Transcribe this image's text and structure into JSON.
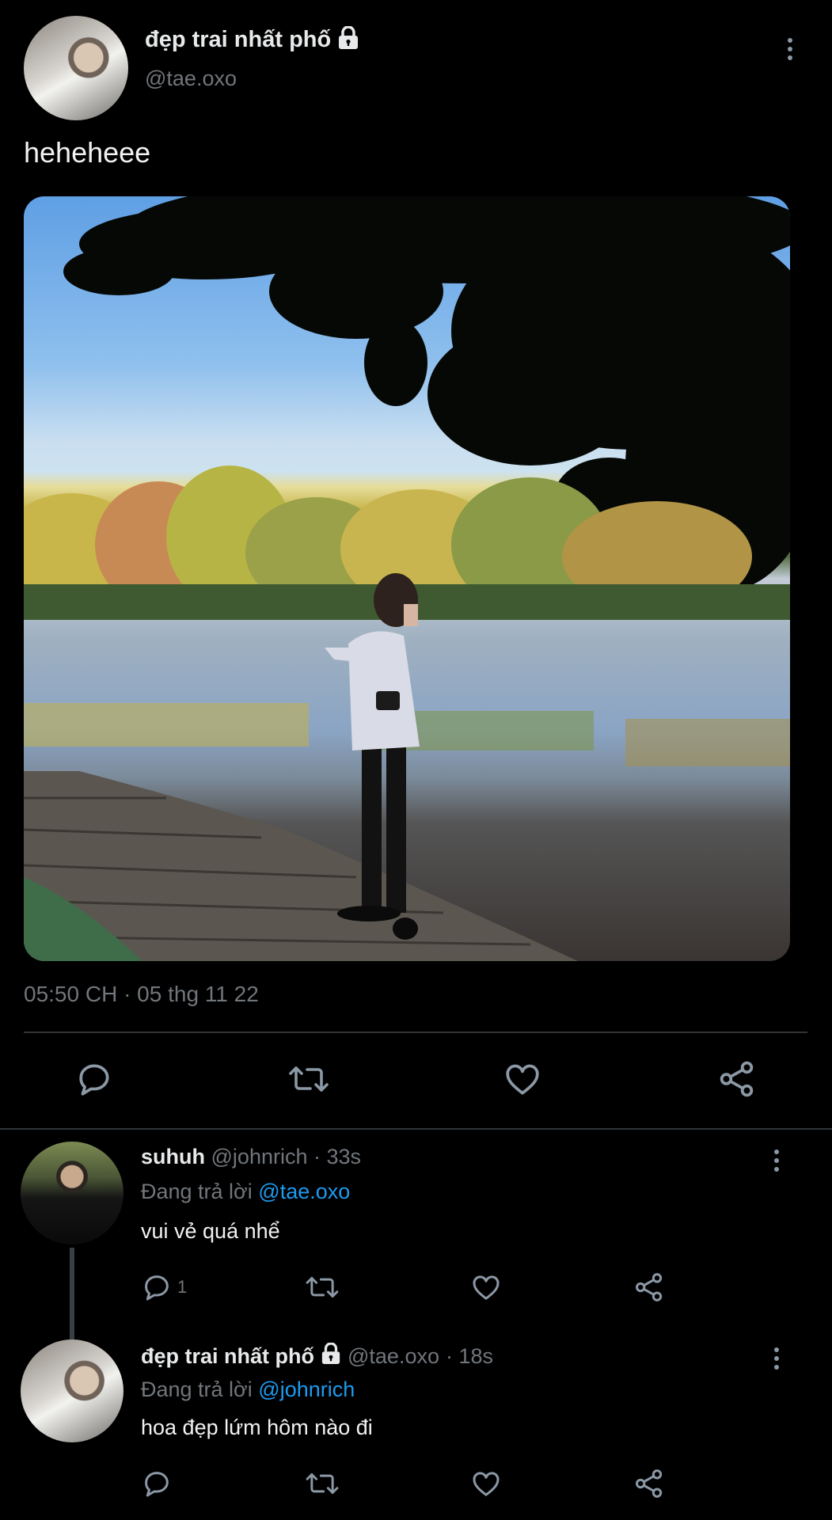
{
  "post": {
    "author_name": "đẹp trai nhất phố",
    "author_handle": "@tae.oxo",
    "text": "heheheee",
    "timestamp": "05:50 CH · 05 thg 11 22",
    "lock_icon": "lock-icon"
  },
  "actions": {
    "icons": [
      "reply-icon",
      "retweet-icon",
      "like-icon",
      "share-icon"
    ]
  },
  "replies": [
    {
      "name": "suhuh",
      "handle": "@johnrich",
      "time": "· 33s",
      "replying_prefix": "Đang trả lời",
      "replying_to": "@tae.oxo",
      "text": "vui vẻ quá nhể",
      "reply_count": "1"
    },
    {
      "name": "đẹp trai nhất phố",
      "handle": "@tae.oxo",
      "time": "· 18s",
      "replying_prefix": "Đang trả lời",
      "replying_to": "@johnrich",
      "text": "hoa đẹp lứm hôm nào đi",
      "reply_count": ""
    }
  ],
  "colors": {
    "background": "#000000",
    "text": "#e7e9ea",
    "muted": "#71767b",
    "link": "#1d9bf0"
  }
}
